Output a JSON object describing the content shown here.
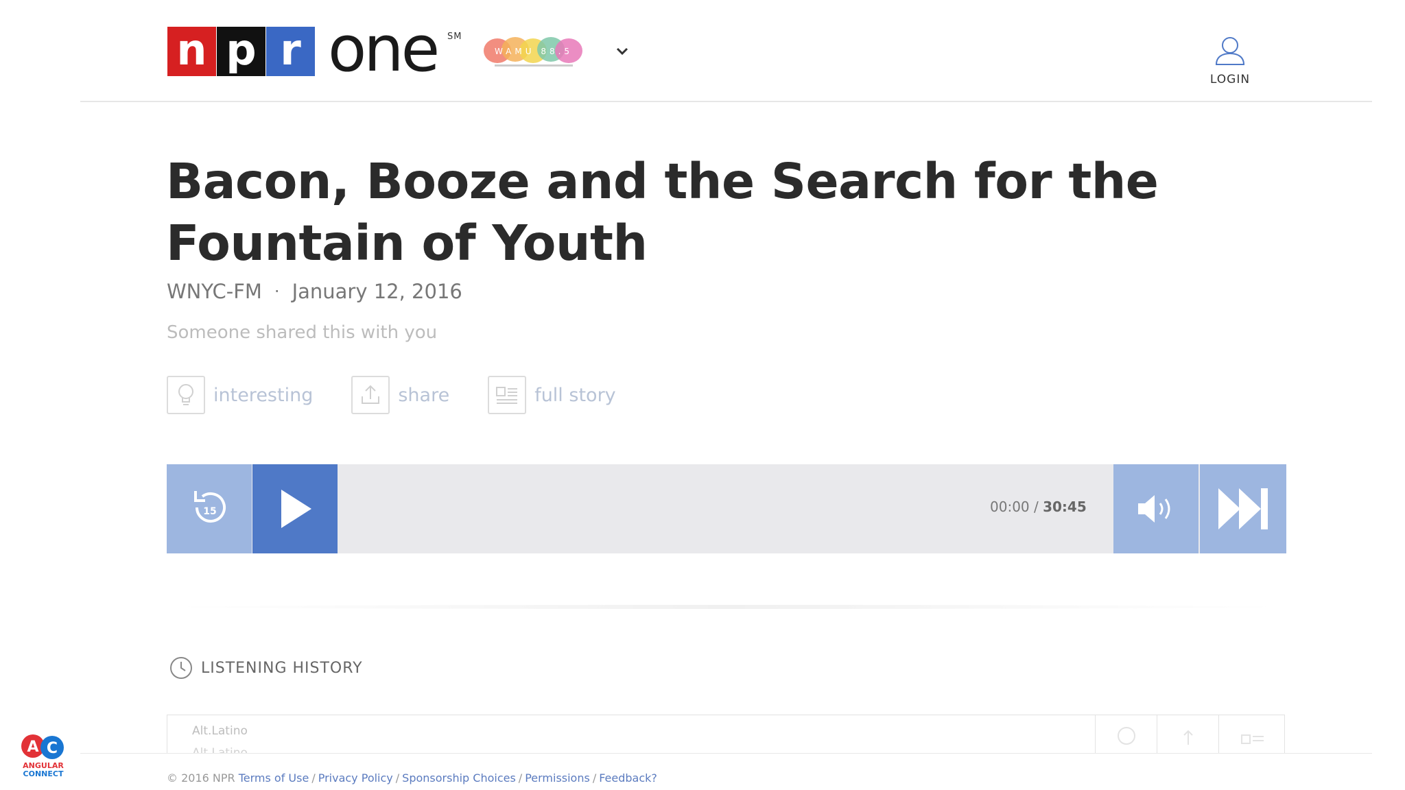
{
  "header": {
    "brand": {
      "n": "n",
      "p": "p",
      "r": "r",
      "one": "one",
      "sm": "SM"
    },
    "station": {
      "name": "WAMU 88.5"
    },
    "login_label": "LOGIN"
  },
  "story": {
    "title": "Bacon, Booze and the Search for the Fountain of Youth",
    "source": "WNYC-FM",
    "separator": "·",
    "date": "January 12, 2016",
    "shared_note": "Someone shared this with you",
    "actions": [
      {
        "label": "interesting",
        "icon": "lightbulb-icon"
      },
      {
        "label": "share",
        "icon": "share-icon"
      },
      {
        "label": "full story",
        "icon": "article-icon"
      }
    ]
  },
  "player": {
    "rewind_seconds": "15",
    "current_time": "00:00",
    "time_separator": " / ",
    "total_time": "30:45",
    "progress": 0
  },
  "history": {
    "heading": "LISTENING HISTORY",
    "items": [
      {
        "program": "Alt.Latino",
        "title": "Alt.Latino"
      }
    ]
  },
  "footer": {
    "copyright": "© 2016 NPR",
    "links": [
      "Terms of Use",
      "Privacy Policy",
      "Sponsorship Choices",
      "Permissions",
      "Feedback?"
    ]
  },
  "badge": {
    "line1": "ANGULAR",
    "line2": "CONNECT"
  },
  "colors": {
    "npr_red": "#d62021",
    "npr_black": "#111111",
    "npr_blue": "#3a68c4",
    "player_light": "#9db6e0",
    "player_dark": "#4f79c7",
    "player_track": "#e9e9ec",
    "link": "#5b7bbf"
  }
}
